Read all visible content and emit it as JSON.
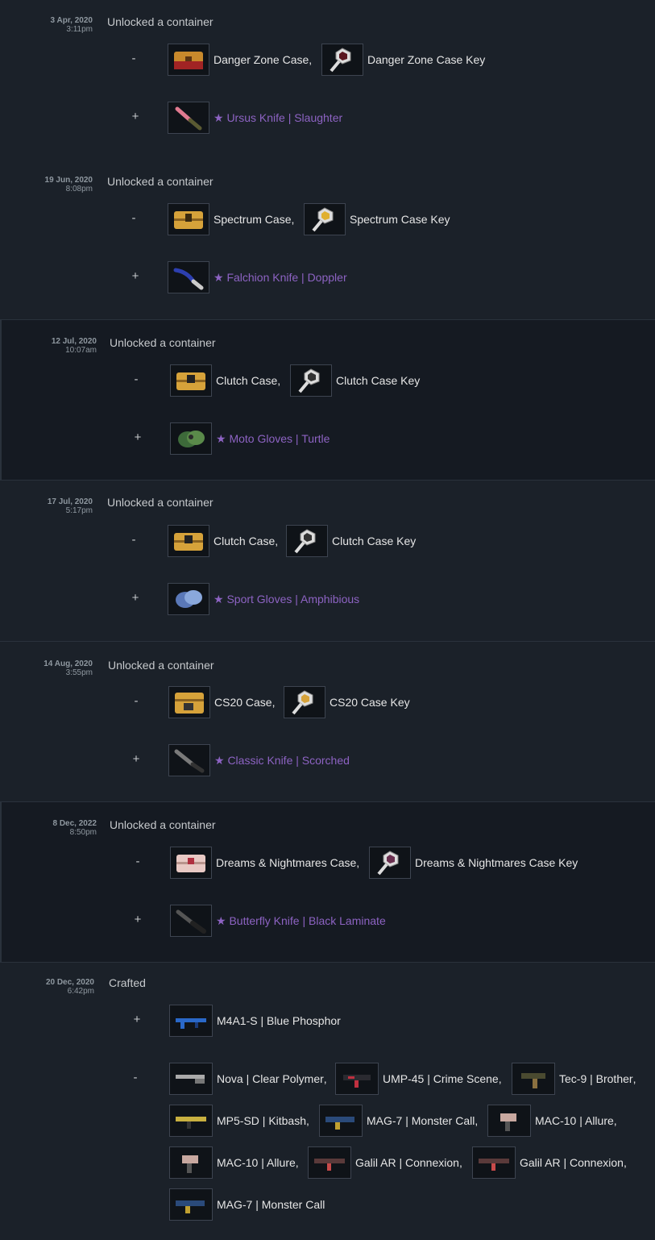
{
  "entries": [
    {
      "date": "3 Apr, 2020",
      "time": "3:11pm",
      "action": "Unlocked a container",
      "minus": [
        {
          "name": "Danger Zone Case",
          "comma": ",",
          "icon": "case-icon"
        },
        {
          "name": "Danger Zone Case Key",
          "icon": "key-icon"
        }
      ],
      "plus": [
        {
          "name": "★ Ursus Knife | Slaughter",
          "icon": "knife-icon"
        }
      ]
    },
    {
      "date": "19 Jun, 2020",
      "time": "8:08pm",
      "action": "Unlocked a container",
      "minus": [
        {
          "name": "Spectrum Case",
          "comma": ",",
          "icon": "case-icon"
        },
        {
          "name": "Spectrum Case Key",
          "icon": "key-icon"
        }
      ],
      "plus": [
        {
          "name": "★ Falchion Knife | Doppler",
          "icon": "knife-icon"
        }
      ]
    },
    {
      "date": "12 Jul, 2020",
      "time": "10:07am",
      "action": "Unlocked a container",
      "minus": [
        {
          "name": "Clutch Case",
          "comma": ",",
          "icon": "case-icon"
        },
        {
          "name": "Clutch Case Key",
          "icon": "key-icon"
        }
      ],
      "plus": [
        {
          "name": "★ Moto Gloves | Turtle",
          "icon": "gloves-icon"
        }
      ]
    },
    {
      "date": "17 Jul, 2020",
      "time": "5:17pm",
      "action": "Unlocked a container",
      "minus": [
        {
          "name": "Clutch Case",
          "comma": ",",
          "icon": "case-icon"
        },
        {
          "name": "Clutch Case Key",
          "icon": "key-icon"
        }
      ],
      "plus": [
        {
          "name": "★ Sport Gloves | Amphibious",
          "icon": "gloves-icon"
        }
      ]
    },
    {
      "date": "14 Aug, 2020",
      "time": "3:55pm",
      "action": "Unlocked a container",
      "minus": [
        {
          "name": "CS20 Case",
          "comma": ",",
          "icon": "case-icon"
        },
        {
          "name": "CS20 Case Key",
          "icon": "key-icon"
        }
      ],
      "plus": [
        {
          "name": "★ Classic Knife | Scorched",
          "icon": "knife-icon"
        }
      ]
    },
    {
      "date": "8 Dec, 2022",
      "time": "8:50pm",
      "action": "Unlocked a container",
      "minus": [
        {
          "name": "Dreams & Nightmares Case",
          "comma": ",",
          "icon": "case-icon"
        },
        {
          "name": "Dreams & Nightmares Case Key",
          "icon": "key-icon"
        }
      ],
      "plus": [
        {
          "name": "★ Butterfly Knife | Black Laminate",
          "icon": "knife-icon"
        }
      ]
    },
    {
      "date": "20 Dec, 2020",
      "time": "6:42pm",
      "action": "Crafted",
      "plus": [
        {
          "name": "M4A1-S | Blue Phosphor",
          "icon": "rifle-icon"
        }
      ],
      "minus": [
        {
          "name": "Nova | Clear Polymer",
          "comma": ",",
          "icon": "shotgun-icon"
        },
        {
          "name": "UMP-45 | Crime Scene",
          "comma": ",",
          "icon": "smg-icon"
        },
        {
          "name": "Tec-9 | Brother",
          "comma": ",",
          "icon": "pistol-icon"
        },
        {
          "name": "MP5-SD | Kitbash",
          "comma": ",",
          "icon": "smg-icon"
        },
        {
          "name": "MAG-7 | Monster Call",
          "comma": ",",
          "icon": "shotgun-icon"
        },
        {
          "name": "MAC-10 | Allure",
          "comma": ",",
          "icon": "smg-icon"
        },
        {
          "name": "MAC-10 | Allure",
          "comma": ",",
          "icon": "smg-icon"
        },
        {
          "name": "Galil AR | Connexion",
          "comma": ",",
          "icon": "rifle-icon"
        },
        {
          "name": "Galil AR | Connexion",
          "comma": ",",
          "icon": "rifle-icon"
        },
        {
          "name": "MAG-7 | Monster Call",
          "icon": "shotgun-icon"
        }
      ]
    }
  ],
  "signs": {
    "minus": "-",
    "plus": "+"
  },
  "colors": {
    "background": "#1b2129",
    "alt_background": "#151a22",
    "rare": "#8d63c3",
    "date": "#8f98a0"
  }
}
